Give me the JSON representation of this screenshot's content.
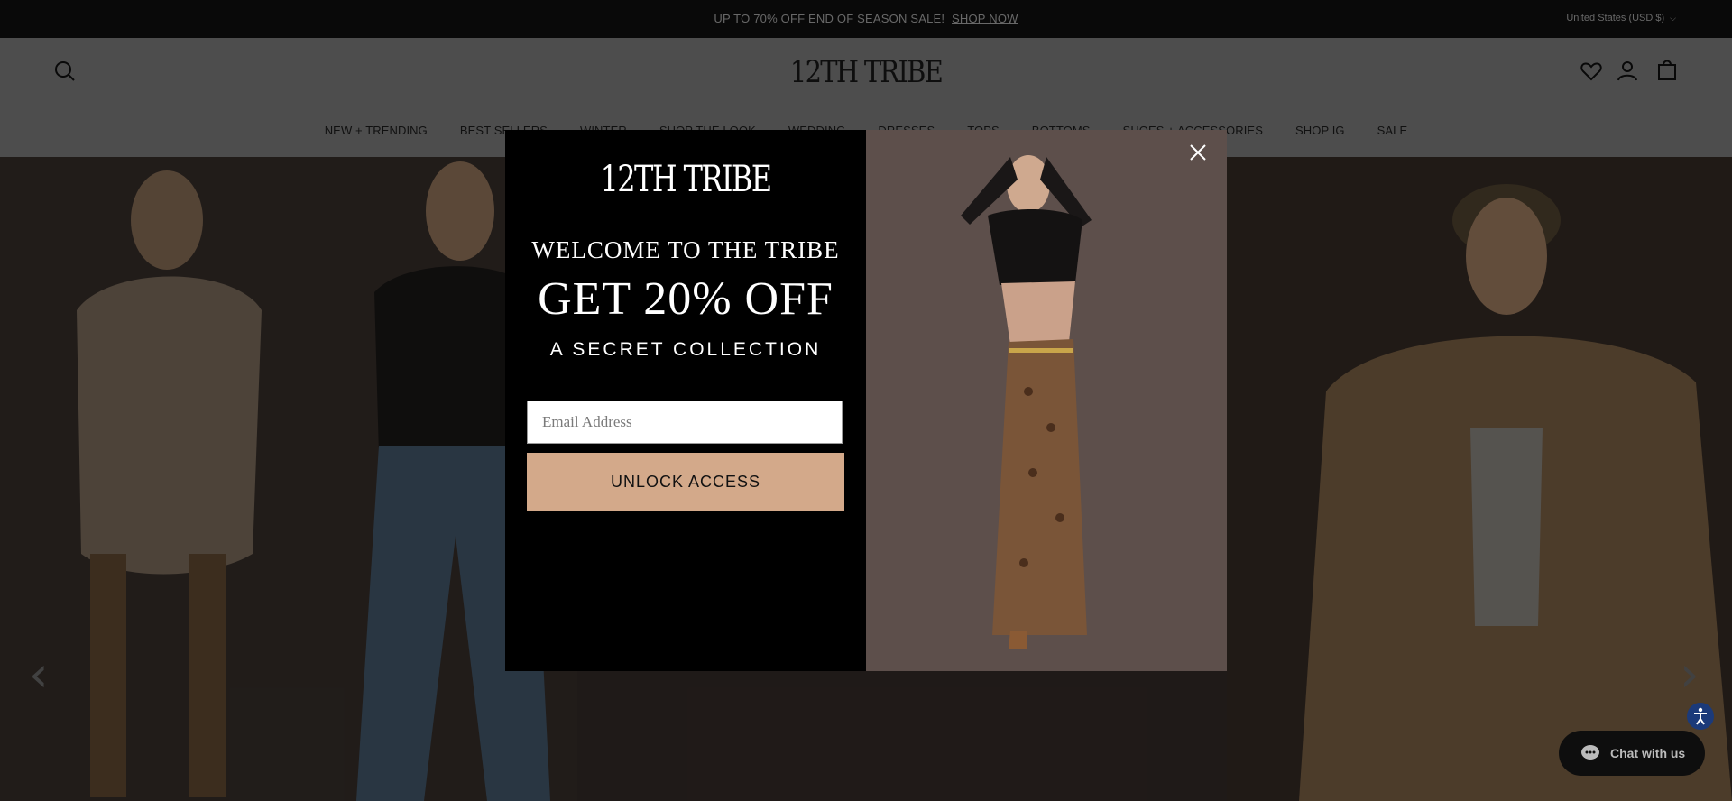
{
  "announcement": {
    "text": "UP TO 70% OFF END OF SEASON SALE!",
    "link": "SHOP NOW"
  },
  "region": {
    "label": "United States (USD $)"
  },
  "header": {
    "logo": "12TH TRIBE",
    "icons": [
      "search-icon",
      "heart-icon",
      "account-icon",
      "cart-icon"
    ],
    "nav": [
      "NEW + TRENDING",
      "BEST SELLERS",
      "WINTER",
      "SHOP THE LOOK",
      "WEDDING",
      "DRESSES",
      "TOPS",
      "BOTTOMS",
      "SHOES + ACCESSORIES",
      "SHOP IG",
      "SALE"
    ]
  },
  "modal": {
    "logo": "12TH TRIBE",
    "welcome": "WELCOME TO THE TRIBE",
    "offer": "GET 20% OFF",
    "subtitle": "A SECRET COLLECTION",
    "email_placeholder": "Email Address",
    "button_label": "UNLOCK ACCESS"
  },
  "chat": {
    "label": "Chat with us"
  },
  "colors": {
    "accent": "#d3a98a",
    "modal_bg": "#000000",
    "overlay": "rgba(0,0,0,0.45)"
  }
}
